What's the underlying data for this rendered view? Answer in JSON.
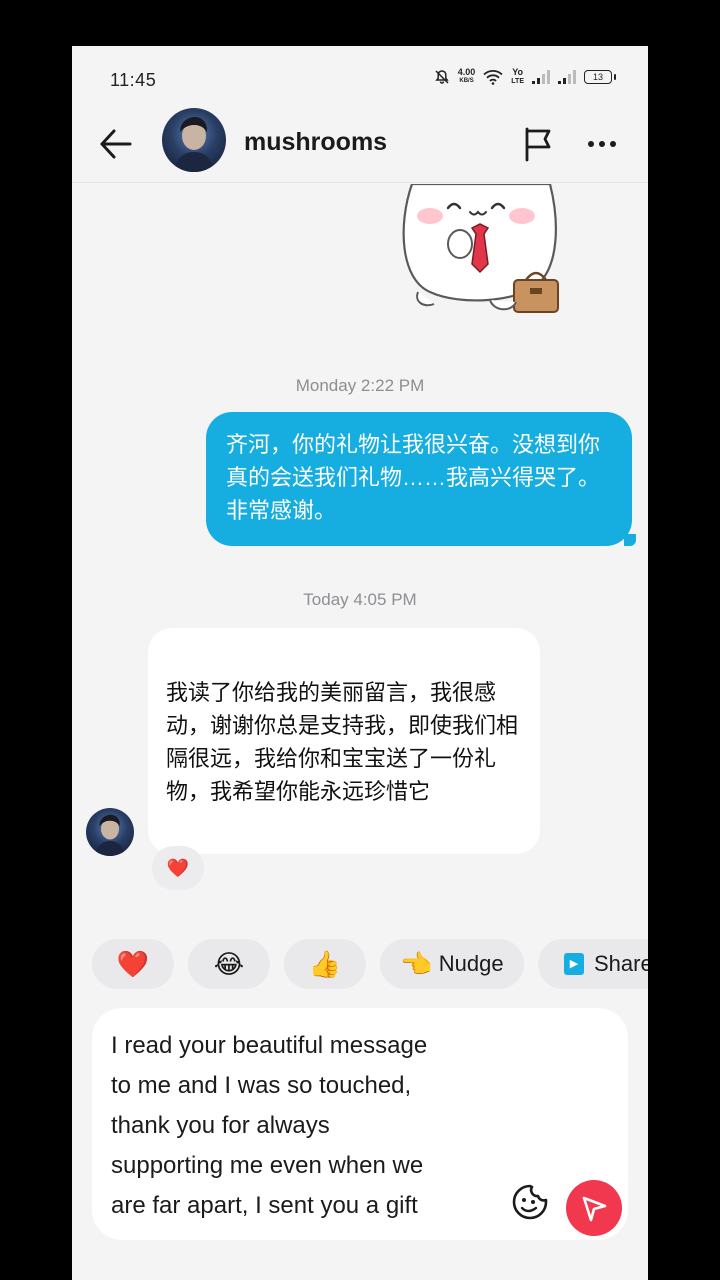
{
  "status_bar": {
    "time": "11:45",
    "network_speed": "4.00",
    "network_unit": "KB/S",
    "volte_top": "Yo",
    "volte_bottom": "LTE",
    "battery": "13"
  },
  "header": {
    "contact_name": "mushrooms",
    "icons": [
      "back-arrow-icon",
      "flag-icon",
      "more-icon"
    ]
  },
  "chat": {
    "timestamp_1": "Monday 2:22 PM",
    "outgoing_message": "齐河，你的礼物让我很兴奋。没想到你真的会送我们礼物……我高兴得哭了。非常感谢。",
    "timestamp_2": "Today 4:05 PM",
    "incoming_message": "我读了你给我的美丽留言，我很感动，谢谢你总是支持我，即使我们相隔很远，我给你和宝宝送了一份礼物，我希望你能永远珍惜它",
    "reaction": "❤️"
  },
  "quick_replies": [
    {
      "emoji": "❤️",
      "label": ""
    },
    {
      "emoji": "😂",
      "label": ""
    },
    {
      "emoji": "👍",
      "label": ""
    },
    {
      "emoji": "👈",
      "label": "Nudge"
    },
    {
      "emoji": "▶",
      "label": "Share"
    }
  ],
  "composer": {
    "text": "I read your beautiful message\nto me and I was so touched,\nthank you for always\nsupporting me even when we\nare far apart, I sent you a gift"
  },
  "colors": {
    "outgoing_bubble": "#16aee0",
    "send_button": "#f2384f",
    "background": "#f4f4f5"
  }
}
